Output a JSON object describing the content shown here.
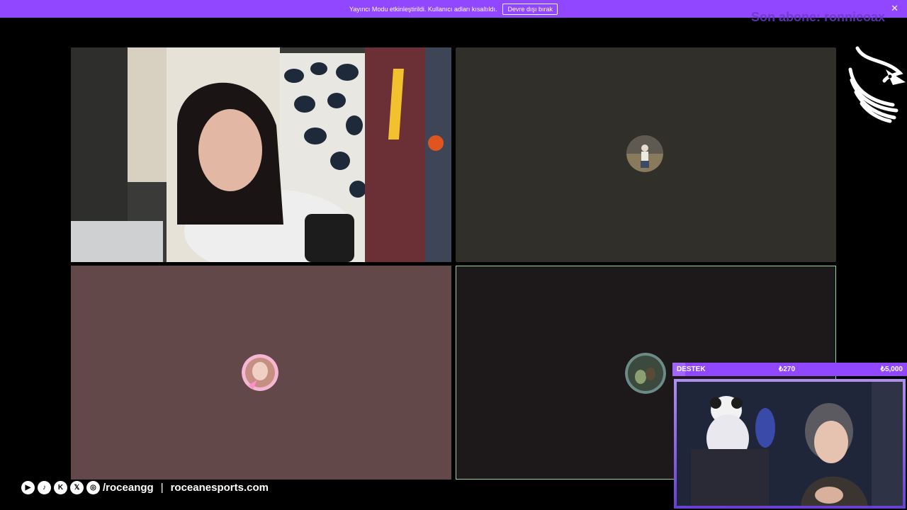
{
  "banner": {
    "message": "Yayıncı Modu etkinleştirildi. Kullanıcı adları kısaltıldı.",
    "disable_button": "Devre dışı bırak",
    "close_icon": "close-icon"
  },
  "overlay": {
    "last_subscriber": "Son abone: ronnieoax"
  },
  "tiles": [
    {
      "name": "participant-1",
      "state": "camera-on"
    },
    {
      "name": "participant-2",
      "state": "camera-off"
    },
    {
      "name": "participant-3",
      "state": "camera-off"
    },
    {
      "name": "participant-4",
      "state": "camera-off",
      "speaking": true
    }
  ],
  "social": {
    "icons": [
      "youtube-icon",
      "tiktok-icon",
      "kick-icon",
      "x-icon",
      "instagram-icon"
    ],
    "handle": "/roceangg",
    "separator": "|",
    "site": "roceanesports.com"
  },
  "donation": {
    "label": "DESTEK",
    "current": "₺270",
    "goal": "₺5,000",
    "progress": 0.054
  },
  "colors": {
    "brand_purple": "#9146ff",
    "speaking_border": "#8fd99e"
  }
}
